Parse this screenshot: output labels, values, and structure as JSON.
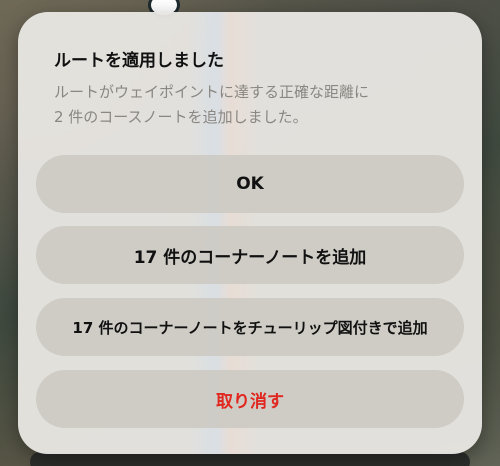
{
  "dialog": {
    "title": "ルートを適用しました",
    "message_line1": "ルートがウェイポイントに達する正確な距離に",
    "message_line2": "2 件のコースノートを追加しました。",
    "buttons": {
      "ok": "OK",
      "add_corner_notes": "17 件のコーナーノートを追加",
      "add_corner_notes_tulip": "17 件のコーナーノートをチューリップ図付きで追加",
      "cancel": "取り消す"
    }
  },
  "colors": {
    "cancel_text": "#e0261f",
    "dialog_background": "#e8e6e2",
    "button_background": "#cdcac4"
  }
}
